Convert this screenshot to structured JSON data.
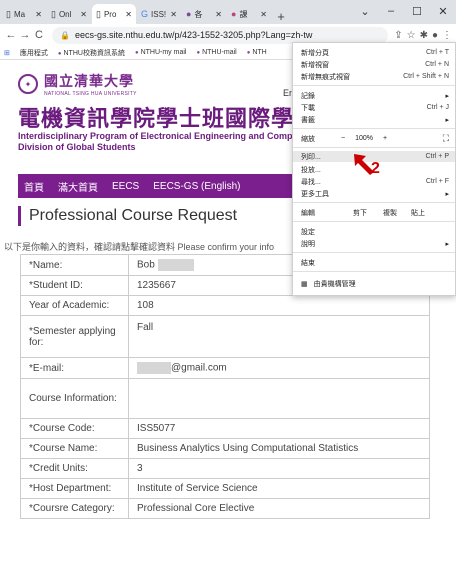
{
  "browser": {
    "tabs": [
      {
        "icon": "▯",
        "label": "Ma"
      },
      {
        "icon": "▯",
        "label": "Onl"
      },
      {
        "icon": "▯",
        "label": "Pro"
      },
      {
        "icon": "G",
        "label": "ISS!"
      },
      {
        "icon": "●",
        "label": "各"
      },
      {
        "icon": "●",
        "label": "課"
      }
    ],
    "url": "eecs-gs.site.nthu.edu.tw/p/423-1552-3205.php?Lang=zh-tw",
    "bookmarks": [
      "應用程式",
      "NTHU校務資訊系統",
      "NTHU-my mail",
      "NTHU-mail",
      "NTH"
    ]
  },
  "page": {
    "logo_cn": "國立清華大學",
    "logo_en": "NATIONAL TSING HUA UNIVERSITY",
    "lang_en": "En",
    "dept_title": "電機資訊學院學士班國際學生",
    "dept_sub1": "Interdisciplinary Program of Electronical Engineering and Compu",
    "dept_sub2": "Division of Global Students",
    "nav": [
      "首頁",
      "滿大首頁",
      "EECS",
      "EECS-GS (English)"
    ],
    "section_title": "Professional Course Request",
    "confirm_text": "以下是你輸入的資料，確認請點擊確認資料 Please confirm your info",
    "form": [
      {
        "label": "*Name:",
        "value": "Bob"
      },
      {
        "label": "*Student ID:",
        "value": "1235667"
      },
      {
        "label": "Year of Academic:",
        "value": "108"
      },
      {
        "label": "*Semester applying for:",
        "value": "Fall"
      },
      {
        "label": "*E-mail:",
        "value": "@gmail.com"
      },
      {
        "label": "Course Information:",
        "value": ""
      },
      {
        "label": "*Course Code:",
        "value": "ISS5077"
      },
      {
        "label": "*Course Name:",
        "value": "Business Analytics Using Computational Statistics"
      },
      {
        "label": "*Credit Units:",
        "value": "3"
      },
      {
        "label": "*Host Department:",
        "value": "Institute of Service Science"
      },
      {
        "label": "*Coursre Category:",
        "value": "Professional Core Elective"
      }
    ]
  },
  "menu": {
    "new_tab": "新增分頁",
    "new_tab_sc": "Ctrl + T",
    "new_window": "新增視窗",
    "new_window_sc": "Ctrl + N",
    "incognito": "新增無痕式視窗",
    "incognito_sc": "Ctrl + Shift + N",
    "history": "記錄",
    "downloads": "下載",
    "downloads_sc": "Ctrl + J",
    "bookmarks": "書籤",
    "zoom": "縮放",
    "zoom_minus": "−",
    "zoom_value": "100%",
    "zoom_plus": "+",
    "print": "列印...",
    "print_sc": "Ctrl + P",
    "cast": "投放...",
    "find": "尋找...",
    "find_sc": "Ctrl + F",
    "more_tools": "更多工具",
    "edit": "編輯",
    "cut": "剪下",
    "copy": "複製",
    "paste": "貼上",
    "settings": "設定",
    "help": "說明",
    "exit": "結束",
    "managed": "由貴機構管理"
  },
  "annotation": {
    "number": "2",
    "color": "#cc0000"
  }
}
